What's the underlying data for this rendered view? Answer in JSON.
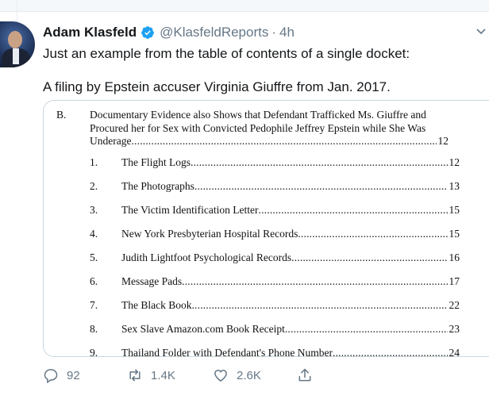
{
  "tweet": {
    "author_name": "Adam Klasfeld",
    "handle": "@KlasfeldReports",
    "separator": "·",
    "time": "4h",
    "text_line1": "Just an example from the table of contents of a single docket:",
    "text_line2": "A filing by Epstein accuser Virginia Giuffre from Jan. 2017."
  },
  "document": {
    "section_letter": "B.",
    "section_title_line1": "Documentary Evidence also Shows that Defendant Trafficked Ms. Giuffre and",
    "section_title_line2": "Procured her for Sex with Convicted Pedophile Jeffrey Epstein while She Was",
    "section_title_line3": "Underage",
    "section_page": "12",
    "entries": [
      {
        "num": "1.",
        "title": "The Flight Logs",
        "page": "12"
      },
      {
        "num": "2.",
        "title": "The Photographs",
        "page": "13"
      },
      {
        "num": "3.",
        "title": "The Victim Identification Letter",
        "page": "15"
      },
      {
        "num": "4.",
        "title": "New York Presbyterian Hospital Records",
        "page": "15"
      },
      {
        "num": "5.",
        "title": "Judith Lightfoot Psychological Records",
        "page": "16"
      },
      {
        "num": "6.",
        "title": "Message Pads",
        "page": "17"
      },
      {
        "num": "7.",
        "title": "The Black Book",
        "page": "22"
      },
      {
        "num": "8.",
        "title": "Sex Slave Amazon.com Book Receipt",
        "page": "23"
      },
      {
        "num": "9.",
        "title": "Thailand Folder with Defendant's Phone Number",
        "page": "24"
      }
    ]
  },
  "actions": {
    "reply_count": "92",
    "retweet_count": "1.4K",
    "like_count": "2.6K"
  },
  "colors": {
    "text": "#14171a",
    "secondary": "#657786",
    "verified": "#1da1f2",
    "border": "#ccd6dd"
  },
  "icons": [
    "verified-badge-icon",
    "chevron-down-icon",
    "reply-icon",
    "retweet-icon",
    "like-icon",
    "share-icon"
  ]
}
